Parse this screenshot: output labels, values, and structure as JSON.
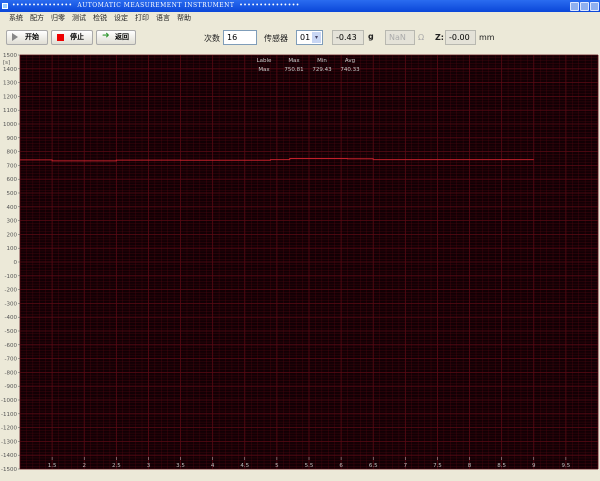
{
  "window": {
    "title": "•••••••••••••••  AUTOMATIC MEASUREMENT INSTRUMENT  •••••••••••••••"
  },
  "menu": [
    "系统",
    "配方",
    "归零",
    "测试",
    "检锐",
    "设定",
    "打印",
    "语言",
    "帮助"
  ],
  "toolbar": {
    "start": "开始",
    "stop": "停止",
    "back": "返回",
    "count_label": "次数",
    "count_value": "16",
    "sensor_label": "传感器",
    "sensor_value": "01",
    "weight_value": "-0.43",
    "weight_unit": "g",
    "resistance_value": "NaN",
    "resistance_unit": "Ω",
    "z_label": "Z:",
    "z_value": "-0.00",
    "z_unit": "mm"
  },
  "colors": {
    "plot_bg": "#120004",
    "grid": "#5a0a14",
    "line": "#c0202a",
    "title_bar": "#0a46d8"
  },
  "stats": {
    "headers": [
      "Lable",
      "Max",
      "Min",
      "Avg"
    ],
    "row": [
      "Max",
      "750.81",
      "729.43",
      "740.33"
    ]
  },
  "chart_data": {
    "type": "line",
    "ylabel": "[s]",
    "xlim": [
      1,
      10
    ],
    "ylim": [
      -1500,
      1500
    ],
    "grid": true,
    "xticks": [
      "1.5",
      "2",
      "2.5",
      "3",
      "3.5",
      "4",
      "4.5",
      "5",
      "5.5",
      "6",
      "6.5",
      "7",
      "7.5",
      "8",
      "8.5",
      "9",
      "9.5"
    ],
    "yticks": [
      "1500",
      "1400",
      "1300",
      "1200",
      "1100",
      "1000",
      "900",
      "800",
      "700",
      "600",
      "500",
      "400",
      "300",
      "200",
      "100",
      "0",
      "-100",
      "-200",
      "-300",
      "-400",
      "-500",
      "-600",
      "-700",
      "-800",
      "-900",
      "-1000",
      "-1100",
      "-1200",
      "-1300",
      "-1400",
      "-1500"
    ],
    "series": [
      {
        "x": [
          1,
          1.5,
          1.5,
          2.5,
          2.5,
          3.5,
          3.5,
          4.9,
          4.9,
          5.2,
          5.2,
          6.1,
          6.1,
          6.5,
          6.5,
          9
        ],
        "values": [
          740,
          740,
          733,
          733,
          738,
          738,
          737,
          737,
          742,
          742,
          750,
          750,
          748,
          748,
          742,
          742
        ]
      }
    ]
  }
}
